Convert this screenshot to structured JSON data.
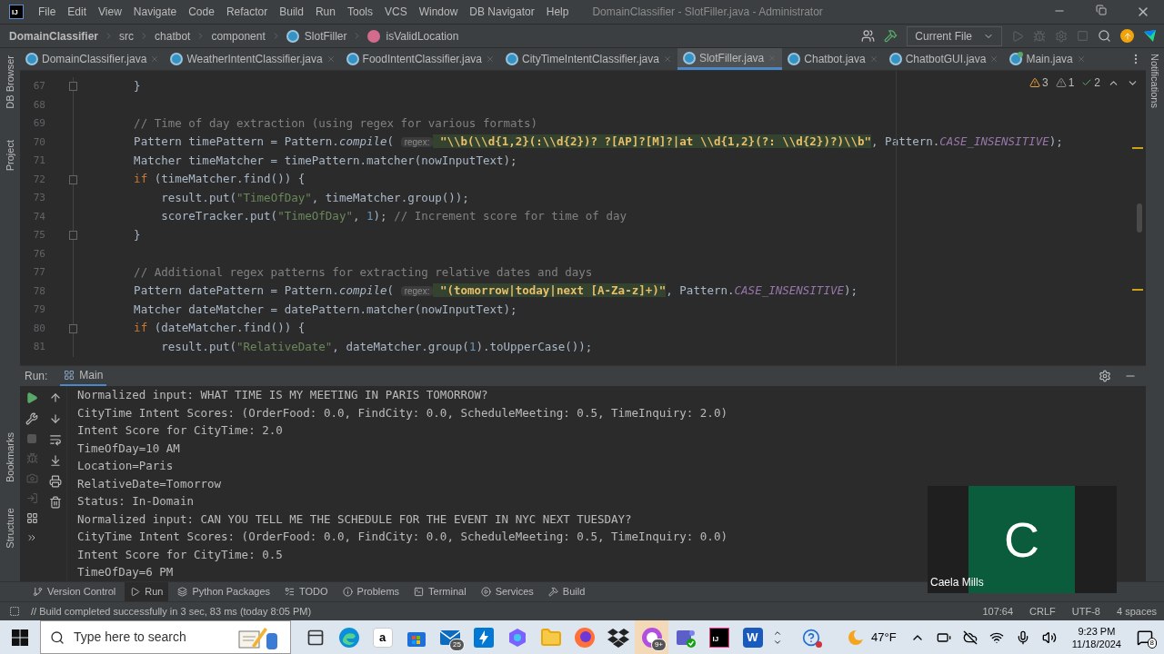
{
  "window": {
    "logo": "IJ",
    "title": "DomainClassifier - SlotFiller.java - Administrator",
    "menu": [
      "File",
      "Edit",
      "View",
      "Navigate",
      "Code",
      "Refactor",
      "Build",
      "Run",
      "Tools",
      "VCS",
      "Window",
      "DB Navigator",
      "Help"
    ]
  },
  "breadcrumbs": [
    {
      "label": "DomainClassifier",
      "kind": "project"
    },
    {
      "label": "src",
      "kind": "folder"
    },
    {
      "label": "chatbot",
      "kind": "folder"
    },
    {
      "label": "component",
      "kind": "folder"
    },
    {
      "label": "SlotFiller",
      "kind": "class"
    },
    {
      "label": "isValidLocation",
      "kind": "method"
    }
  ],
  "toolbar": {
    "run_config": "Current File"
  },
  "side_tools": {
    "top": [
      "DB Browser",
      "Project"
    ],
    "bottom": [
      "Bookmarks",
      "Structure"
    ]
  },
  "right_tools": [
    "Notifications"
  ],
  "editor_tabs": [
    {
      "label": "DomainClassifier.java",
      "kind": "class",
      "selected": false
    },
    {
      "label": "WeatherIntentClassifier.java",
      "kind": "class",
      "selected": false
    },
    {
      "label": "FoodIntentClassifier.java",
      "kind": "class",
      "selected": false
    },
    {
      "label": "CityTimeIntentClassifier.java",
      "kind": "class",
      "selected": false
    },
    {
      "label": "SlotFiller.java",
      "kind": "class",
      "selected": true
    },
    {
      "label": "Chatbot.java",
      "kind": "class",
      "selected": false
    },
    {
      "label": "ChatbotGUI.java",
      "kind": "class",
      "selected": false
    },
    {
      "label": "Main.java",
      "kind": "main",
      "selected": false
    }
  ],
  "inspections": [
    {
      "kind": "warning",
      "count": "3"
    },
    {
      "kind": "weak",
      "count": "1"
    },
    {
      "kind": "typo",
      "count": "2"
    }
  ],
  "code": [
    {
      "number": "67",
      "fold": true,
      "tokens": [
        {
          "kind": "plain",
          "t": "    }"
        }
      ]
    },
    {
      "number": "68",
      "fold": false
    },
    {
      "number": "69",
      "fold": false,
      "tokens": [
        {
          "kind": "comment",
          "t": "    // Time of day extraction (using regex for various formats)"
        }
      ]
    },
    {
      "number": "70",
      "fold": false,
      "tokens": [
        {
          "kind": "plain",
          "t": "    Pattern timePattern = Pattern."
        },
        {
          "kind": "static",
          "t": "compile"
        },
        {
          "kind": "plain",
          "t": "( "
        },
        {
          "kind": "hint",
          "t": "regex:"
        },
        {
          "kind": "regex",
          "t": " \"\\\\b(\\\\d{1,2}(:\\\\d{2})? ?[AP]?[M]?|at \\\\d{1,2}(?: \\\\d{2})?)\\\\b\""
        },
        {
          "kind": "plain",
          "t": ", Pattern."
        },
        {
          "kind": "constant",
          "t": "CASE_INSENSITIVE"
        },
        {
          "kind": "plain",
          "t": ");"
        }
      ]
    },
    {
      "number": "71",
      "fold": false,
      "tokens": [
        {
          "kind": "plain",
          "t": "    Matcher timeMatcher = timePattern.matcher(nowInputText);"
        }
      ]
    },
    {
      "number": "72",
      "fold": true,
      "tokens": [
        {
          "kind": "keyword",
          "t": "    if"
        },
        {
          "kind": "plain",
          "t": " (timeMatcher.find()) {"
        }
      ]
    },
    {
      "number": "73",
      "fold": false,
      "tokens": [
        {
          "kind": "plain",
          "t": "        result.put("
        },
        {
          "kind": "string",
          "t": "\"TimeOfDay\""
        },
        {
          "kind": "plain",
          "t": ", timeMatcher.group());"
        }
      ]
    },
    {
      "number": "74",
      "fold": false,
      "tokens": [
        {
          "kind": "plain",
          "t": "        scoreTracker.put("
        },
        {
          "kind": "string",
          "t": "\"TimeOfDay\""
        },
        {
          "kind": "plain",
          "t": ", "
        },
        {
          "kind": "number",
          "t": "1"
        },
        {
          "kind": "plain",
          "t": "); "
        },
        {
          "kind": "comment",
          "t": "// Increment score for time of day"
        }
      ]
    },
    {
      "number": "75",
      "fold": true,
      "tokens": [
        {
          "kind": "plain",
          "t": "    }"
        }
      ]
    },
    {
      "number": "76",
      "fold": false
    },
    {
      "number": "77",
      "fold": false,
      "tokens": [
        {
          "kind": "comment",
          "t": "    // Additional regex patterns for extracting relative dates and days"
        }
      ]
    },
    {
      "number": "78",
      "fold": false,
      "tokens": [
        {
          "kind": "plain",
          "t": "    Pattern datePattern = Pattern."
        },
        {
          "kind": "static",
          "t": "compile"
        },
        {
          "kind": "plain",
          "t": "( "
        },
        {
          "kind": "hint",
          "t": "regex:"
        },
        {
          "kind": "regex",
          "t": " \"(tomorrow|today|next [A-Za-z]+)\""
        },
        {
          "kind": "plain",
          "t": ", Pattern."
        },
        {
          "kind": "constant",
          "t": "CASE_INSENSITIVE"
        },
        {
          "kind": "plain",
          "t": ");"
        }
      ]
    },
    {
      "number": "79",
      "fold": false,
      "tokens": [
        {
          "kind": "plain",
          "t": "    Matcher dateMatcher = datePattern.matcher(nowInputText);"
        }
      ]
    },
    {
      "number": "80",
      "fold": true,
      "tokens": [
        {
          "kind": "keyword",
          "t": "    if"
        },
        {
          "kind": "plain",
          "t": " (dateMatcher.find()) {"
        }
      ]
    },
    {
      "number": "81",
      "fold": false,
      "tokens": [
        {
          "kind": "plain",
          "t": "        result.put("
        },
        {
          "kind": "string",
          "t": "\"RelativeDate\""
        },
        {
          "kind": "plain",
          "t": ", dateMatcher.group("
        },
        {
          "kind": "number",
          "t": "1"
        },
        {
          "kind": "plain",
          "t": ").toUpperCase());"
        }
      ]
    }
  ],
  "run_panel": {
    "label": "Run:",
    "tab": "Main",
    "output": [
      "Normalized input: WHAT TIME IS MY MEETING IN PARIS TOMORROW?",
      "CityTime Intent Scores: (OrderFood: 0.0, FindCity: 0.0, ScheduleMeeting: 0.5, TimeInquiry: 2.0)",
      "Intent Score for CityTime: 2.0",
      "TimeOfDay=10 AM",
      "Location=Paris",
      "RelativeDate=Tomorrow",
      "Status: In-Domain",
      "Normalized input: CAN YOU TELL ME THE SCHEDULE FOR THE EVENT IN NYC NEXT TUESDAY?",
      "CityTime Intent Scores: (OrderFood: 0.0, FindCity: 0.0, ScheduleMeeting: 0.5, TimeInquiry: 0.0)",
      "Intent Score for CityTime: 0.5",
      "TimeOfDay=6 PM"
    ]
  },
  "video": {
    "initial": "C",
    "name": "Caela Mills"
  },
  "tool_windows": [
    {
      "label": "Version Control",
      "kind": "vcs",
      "selected": false
    },
    {
      "label": "Run",
      "kind": "run",
      "selected": true
    },
    {
      "label": "Python Packages",
      "kind": "packages",
      "selected": false
    },
    {
      "label": "TODO",
      "kind": "todo",
      "selected": false
    },
    {
      "label": "Problems",
      "kind": "problems",
      "selected": false
    },
    {
      "label": "Terminal",
      "kind": "terminal",
      "selected": false
    },
    {
      "label": "Services",
      "kind": "services",
      "selected": false
    },
    {
      "label": "Build",
      "kind": "build",
      "selected": false
    }
  ],
  "status": {
    "message": "// Build completed successfully in 3 sec, 83 ms (today 8:05 PM)",
    "items": [
      "107:64",
      "CRLF",
      "UTF-8",
      "4 spaces"
    ]
  },
  "taskbar": {
    "search_placeholder": "Type here to search",
    "apps": [
      {
        "kind": "taskview"
      },
      {
        "kind": "edge"
      },
      {
        "kind": "amazon",
        "label": "a"
      },
      {
        "kind": "store"
      },
      {
        "kind": "mail",
        "badge": "25"
      },
      {
        "kind": "bolt"
      },
      {
        "kind": "copilot"
      },
      {
        "kind": "files"
      },
      {
        "kind": "firefox"
      },
      {
        "kind": "dropbox"
      },
      {
        "kind": "chat",
        "badge": "9+"
      },
      {
        "kind": "teams"
      },
      {
        "kind": "intellij",
        "label": "IJ"
      },
      {
        "kind": "word",
        "label": "W"
      }
    ],
    "weather": "47°F",
    "time": "9:23 PM",
    "date": "11/18/2024",
    "notifications": "8"
  }
}
